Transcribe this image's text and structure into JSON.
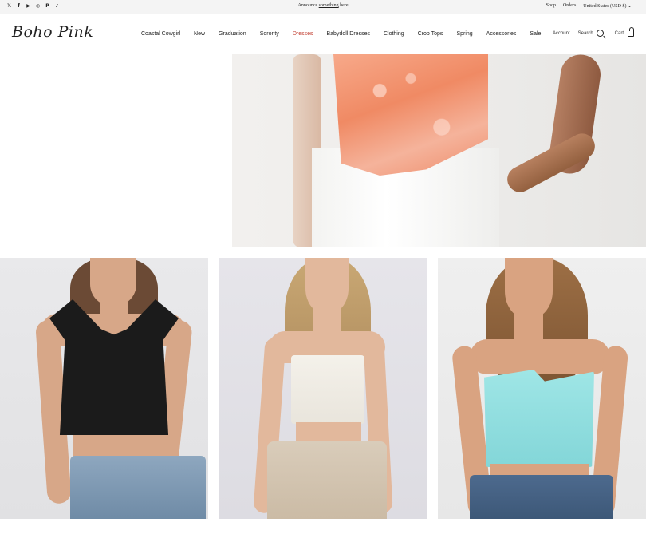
{
  "announcement": {
    "text_before": "Announce ",
    "link_text": "something",
    "text_after": " here"
  },
  "socials": [
    {
      "icon": "twitter-icon",
      "glyph": "𝕏"
    },
    {
      "icon": "facebook-icon",
      "glyph": "f"
    },
    {
      "icon": "youtube-icon",
      "glyph": "▶"
    },
    {
      "icon": "instagram-icon",
      "glyph": "◎"
    },
    {
      "icon": "pinterest-icon",
      "glyph": "P"
    },
    {
      "icon": "tiktok-icon",
      "glyph": "♪"
    }
  ],
  "utility": {
    "shop": "Shop",
    "orders": "Orders",
    "currency": "United States (USD $)"
  },
  "header": {
    "logo": "Boho Pink",
    "nav": [
      "Coastal Cowgirl",
      "New",
      "Graduation",
      "Sorority",
      "Dresses",
      "Babydoll Dresses",
      "Clothing",
      "Crop Tops",
      "Spring",
      "Accessories",
      "Sale"
    ],
    "account": "Account",
    "search": "Search",
    "cart": "Cart"
  },
  "colors": {
    "accent_red": "#c0392b",
    "topbar_bg": "#f4f4f4"
  },
  "products": [
    {
      "name": "black-lace-up-crop-top"
    },
    {
      "name": "white-tube-top"
    },
    {
      "name": "aqua-twist-tube-top"
    }
  ]
}
